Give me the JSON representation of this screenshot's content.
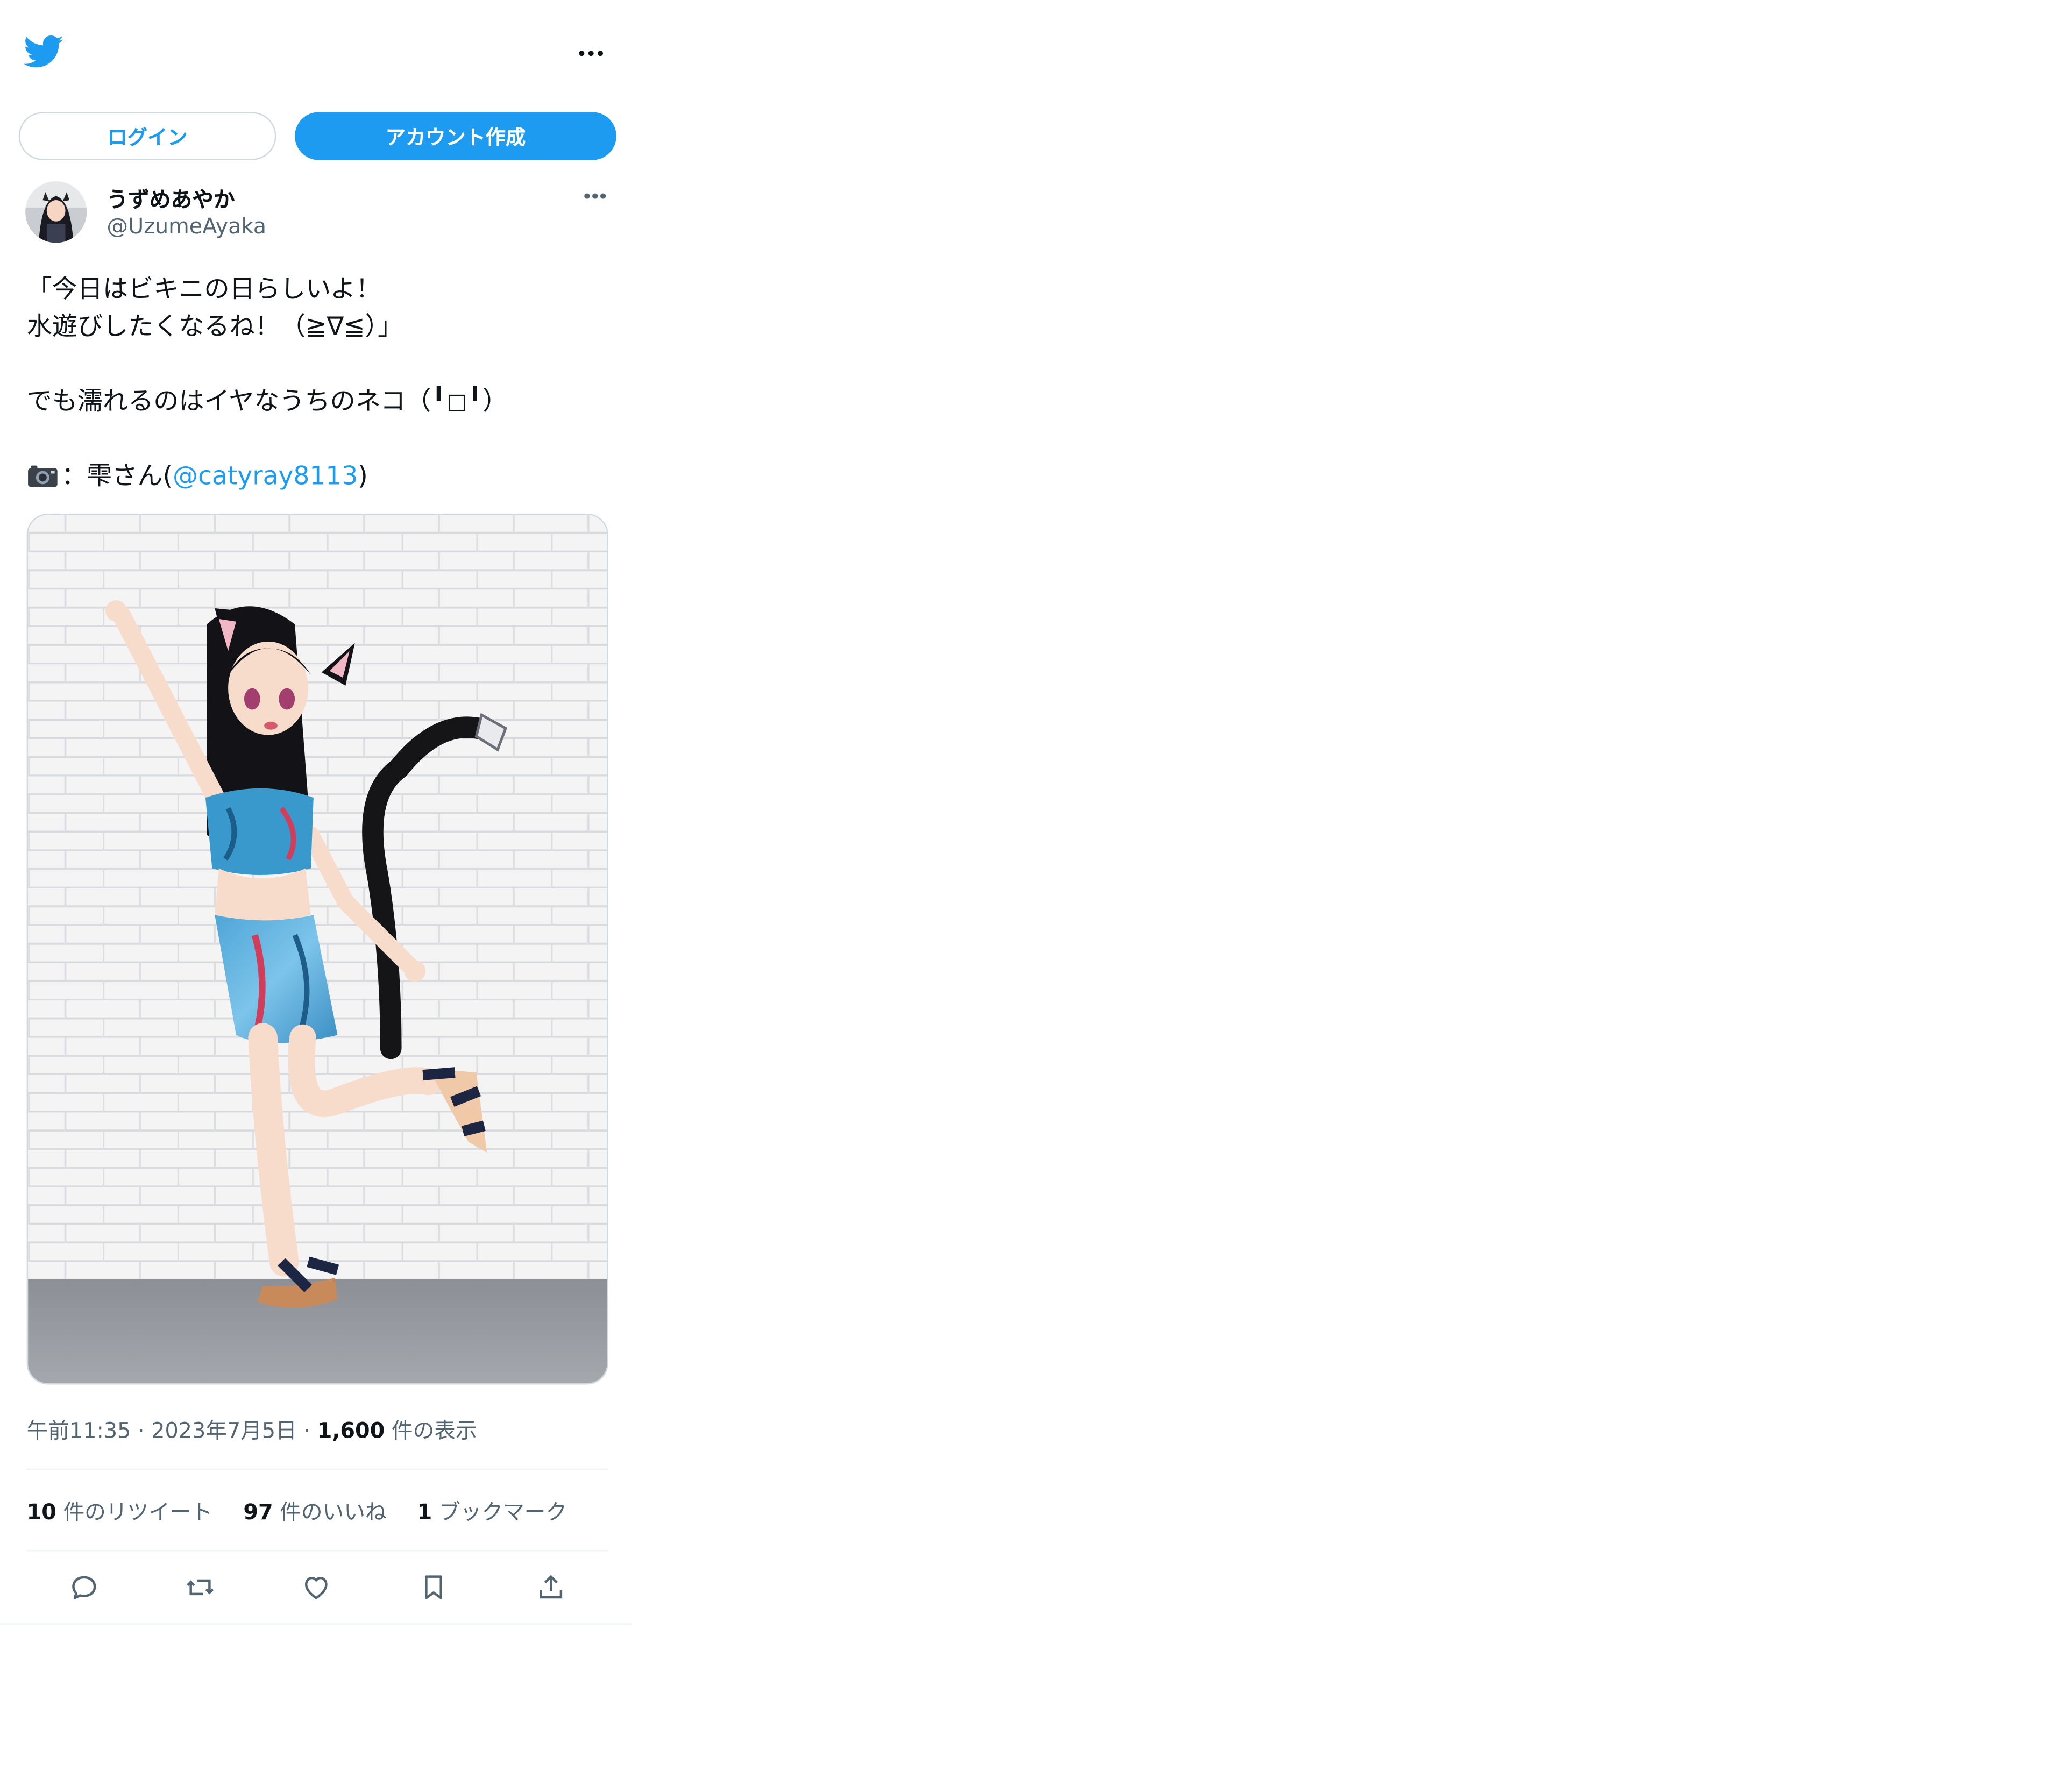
{
  "header": {
    "logo_icon": "twitter-bird-icon",
    "more_icon": "more-horizontal-icon"
  },
  "auth": {
    "login_label": "ログイン",
    "signup_label": "アカウント作成"
  },
  "tweet": {
    "display_name": "うずめあやか",
    "handle": "@UzumeAyaka",
    "text_lines": [
      "「今日はビキニの日らしいよ！",
      "水遊びしたくなるね！（≧∇≦）」",
      "",
      "でも濡れるのはイヤなうちのネコ（╹◻╹）",
      ""
    ],
    "credit_prefix": "：雫さん(",
    "credit_mention": "@catyray8113",
    "credit_suffix": ")",
    "credit_icon": "camera-icon",
    "media_icon": "photo",
    "time": "午前11:35",
    "date": "2023年7月5日",
    "views_count": "1,600",
    "views_label": "件の表示",
    "separator": "·"
  },
  "stats": {
    "retweets_count": "10",
    "retweets_label": "件のリツイート",
    "likes_count": "97",
    "likes_label": "件のいいね",
    "bookmarks_count": "1",
    "bookmarks_label": "ブックマーク"
  },
  "actions": [
    {
      "name": "reply",
      "icon": "reply-icon"
    },
    {
      "name": "retweet",
      "icon": "retweet-icon"
    },
    {
      "name": "like",
      "icon": "heart-icon"
    },
    {
      "name": "bookmark",
      "icon": "bookmark-icon"
    },
    {
      "name": "share",
      "icon": "share-icon"
    }
  ],
  "colors": {
    "accent": "#1d9bf0",
    "text": "#0f1419",
    "secondary": "#536471",
    "border": "#cfd9de"
  }
}
